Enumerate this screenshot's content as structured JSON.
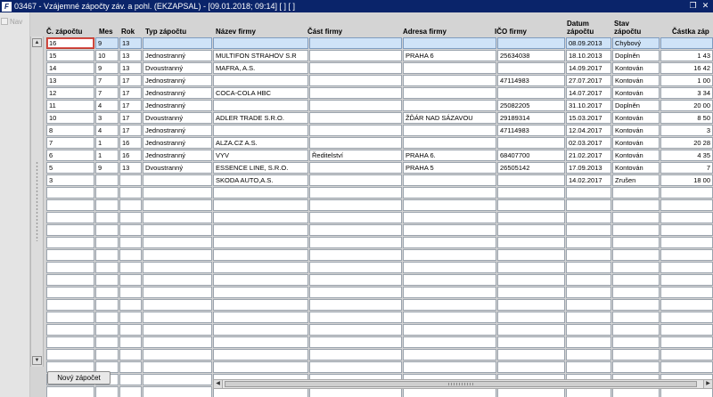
{
  "window": {
    "app_icon": "F",
    "title": "03467 - Vzájemné zápočty záv. a pohl. (EKZAPSAL) - [09.01.2018; 09:14]  [ ] [ ]",
    "restore_icon": "restore-icon",
    "close_icon": "close-icon"
  },
  "nav": {
    "label": "Nav"
  },
  "columns": [
    {
      "key": "cislo",
      "label": "Č. zápočtu"
    },
    {
      "key": "mes",
      "label": "Mes"
    },
    {
      "key": "rok",
      "label": "Rok"
    },
    {
      "key": "typ",
      "label": "Typ zápočtu"
    },
    {
      "key": "nazev",
      "label": "Název firmy"
    },
    {
      "key": "cast",
      "label": "Část firmy"
    },
    {
      "key": "adresa",
      "label": "Adresa firmy"
    },
    {
      "key": "ico",
      "label": "IČO firmy"
    },
    {
      "key": "datum",
      "label": "Datum zápočtu"
    },
    {
      "key": "stav",
      "label": "Stav zápočtu"
    },
    {
      "key": "castka",
      "label": "Částka záp"
    }
  ],
  "rows": [
    {
      "cislo": "16",
      "mes": "9",
      "rok": "13",
      "typ": "",
      "nazev": "",
      "cast": "",
      "adresa": "",
      "ico": "",
      "datum": "08.09.2013",
      "stav": "Chybový",
      "castka": ""
    },
    {
      "cislo": "15",
      "mes": "10",
      "rok": "13",
      "typ": "Jednostranný",
      "nazev": "MULTIFON STRAHOV S.R",
      "cast": "",
      "adresa": "PRAHA 6",
      "ico": "25634038",
      "datum": "18.10.2013",
      "stav": "Doplněn",
      "castka": "1 43"
    },
    {
      "cislo": "14",
      "mes": "9",
      "rok": "13",
      "typ": "Dvoustranný",
      "nazev": "MAFRA, A.S.",
      "cast": "",
      "adresa": "",
      "ico": "",
      "datum": "14.09.2017",
      "stav": "Kontován",
      "castka": "16 42"
    },
    {
      "cislo": "13",
      "mes": "7",
      "rok": "17",
      "typ": "Jednostranný",
      "nazev": "",
      "cast": "",
      "adresa": "",
      "ico": "47114983",
      "datum": "27.07.2017",
      "stav": "Kontován",
      "castka": "1 00"
    },
    {
      "cislo": "12",
      "mes": "7",
      "rok": "17",
      "typ": "Jednostranný",
      "nazev": "COCA-COLA HBC",
      "cast": "",
      "adresa": "",
      "ico": "",
      "datum": "14.07.2017",
      "stav": "Kontován",
      "castka": "3 34"
    },
    {
      "cislo": "11",
      "mes": "4",
      "rok": "17",
      "typ": "Jednostranný",
      "nazev": "",
      "cast": "",
      "adresa": "",
      "ico": "25082205",
      "datum": "31.10.2017",
      "stav": "Doplněn",
      "castka": "20 00"
    },
    {
      "cislo": "10",
      "mes": "3",
      "rok": "17",
      "typ": "Dvoustranný",
      "nazev": "ADLER TRADE S.R.O.",
      "cast": "",
      "adresa": "ŽĎÁR NAD SÁZAVOU",
      "ico": "29189314",
      "datum": "15.03.2017",
      "stav": "Kontován",
      "castka": "8 50"
    },
    {
      "cislo": "8",
      "mes": "4",
      "rok": "17",
      "typ": "Jednostranný",
      "nazev": "",
      "cast": "",
      "adresa": "",
      "ico": "47114983",
      "datum": "12.04.2017",
      "stav": "Kontován",
      "castka": "3"
    },
    {
      "cislo": "7",
      "mes": "1",
      "rok": "16",
      "typ": "Jednostranný",
      "nazev": "ALZA.CZ A.S.",
      "cast": "",
      "adresa": "",
      "ico": "",
      "datum": "02.03.2017",
      "stav": "Kontován",
      "castka": "20 28"
    },
    {
      "cislo": "6",
      "mes": "1",
      "rok": "16",
      "typ": "Jednostranný",
      "nazev": "VYV",
      "cast": "Ředitelství",
      "adresa": "PRAHA 6.",
      "ico": "68407700",
      "datum": "21.02.2017",
      "stav": "Kontován",
      "castka": "4 35"
    },
    {
      "cislo": "5",
      "mes": "9",
      "rok": "13",
      "typ": "Dvoustranný",
      "nazev": "ESSENCE LINE, S.R.O.",
      "cast": "",
      "adresa": "PRAHA  5",
      "ico": "26505142",
      "datum": "17.09.2013",
      "stav": "Kontován",
      "castka": "7"
    },
    {
      "cislo": "3",
      "mes": "",
      "rok": "",
      "typ": "",
      "nazev": "SKODA AUTO,A.S.",
      "cast": "",
      "adresa": "",
      "ico": "",
      "datum": "14.02.2017",
      "stav": "Zrušen",
      "castka": "18 00"
    }
  ],
  "empty_row_count": 17,
  "selected_row_index": 0,
  "buttons": {
    "new_label": "Nový zápočet"
  },
  "colors": {
    "titlebar": "#0a246a",
    "selected_row": "#cfe3f7",
    "focus_border": "#c0392b"
  }
}
